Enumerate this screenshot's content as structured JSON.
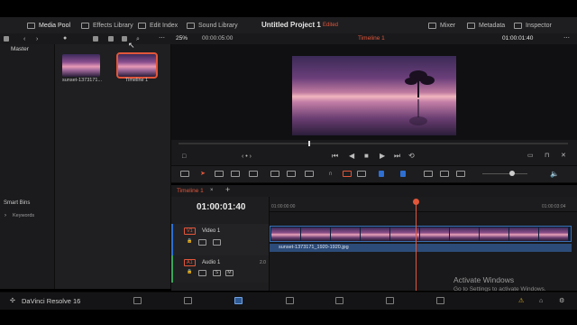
{
  "toolbar": {
    "media_pool": "Media Pool",
    "effects_library": "Effects Library",
    "edit_index": "Edit Index",
    "sound_library": "Sound Library",
    "project_title": "Untitled Project 1",
    "edited": "Edited",
    "mixer": "Mixer",
    "metadata": "Metadata",
    "inspector": "Inspector"
  },
  "subbar": {
    "zoom": "25%",
    "source_timecode": "00:00:05:00",
    "timeline_name": "Timeline 1",
    "record_timecode": "01:00:01:40"
  },
  "left": {
    "master": "Master",
    "smart_bins": "Smart Bins",
    "keywords": "Keywords"
  },
  "media_pool": {
    "clips": [
      {
        "label": "sunset-1373171..."
      },
      {
        "label": "Timeline 1"
      }
    ]
  },
  "timeline": {
    "tab": "Timeline 1",
    "timecode": "01:00:01:40",
    "ruler_start": "01:00:00:00",
    "ruler_end": "01:00:03:04",
    "video_track": {
      "badge": "V1",
      "name": "Video 1"
    },
    "audio_track": {
      "badge": "A1",
      "name": "Audio 1",
      "level": "2.0",
      "solo": "S",
      "mute": "M"
    },
    "clip_name": "sunset-1373171_1920-1920.jpg"
  },
  "watermark": {
    "line1": "Activate Windows",
    "line2": "Go to Settings to activate Windows."
  },
  "bottom": {
    "brand": "DaVinci Resolve 16"
  }
}
